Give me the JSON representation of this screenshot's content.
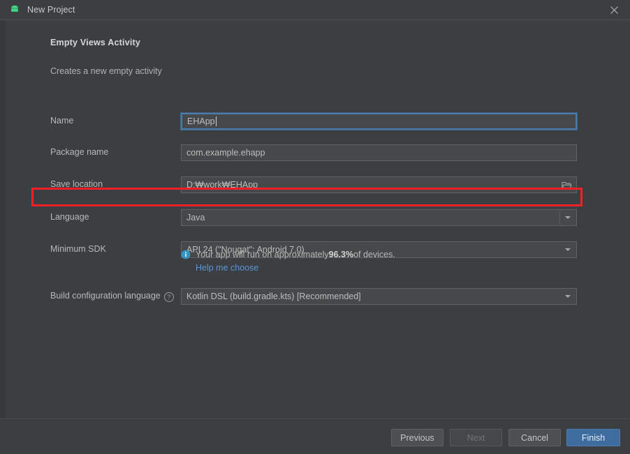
{
  "window": {
    "title": "New Project",
    "app_icon": "android-robot-icon",
    "close_icon": "close-icon"
  },
  "header": {
    "title": "Empty Views Activity",
    "description": "Creates a new empty activity"
  },
  "form": {
    "name": {
      "label": "Name",
      "value": "EHApp",
      "focused": true
    },
    "package_name": {
      "label": "Package name",
      "value": "com.example.ehapp"
    },
    "save_location": {
      "label": "Save location",
      "value": "D:₩work₩EHApp",
      "browse_icon": "folder-open-icon"
    },
    "language": {
      "label": "Language",
      "value": "Java",
      "highlighted": true
    },
    "minimum_sdk": {
      "label": "Minimum SDK",
      "value": "API 24 (\"Nougat\"; Android 7.0)"
    },
    "sdk_info": {
      "icon": "info-icon",
      "text_before": "Your app will run on approximately ",
      "percent": "96.3%",
      "text_after": " of devices.",
      "link": "Help me choose"
    },
    "build_configuration_language": {
      "label": "Build configuration language",
      "help_icon": "question-mark-icon",
      "help_glyph": "?",
      "value": "Kotlin DSL (build.gradle.kts) [Recommended]"
    }
  },
  "footer": {
    "previous": "Previous",
    "next": "Next",
    "next_disabled": true,
    "cancel": "Cancel",
    "finish": "Finish"
  },
  "colors": {
    "window_background": "#3c3f41",
    "field_background": "#45494a",
    "field_border": "#5e6363",
    "focus_border": "#4b7ba8",
    "annotation_red": "#fb1f27",
    "link_blue": "#5b93d4",
    "primary_button": "#3f6c9e",
    "android_green": "#3ddc84",
    "info_blue": "#3592c4"
  }
}
